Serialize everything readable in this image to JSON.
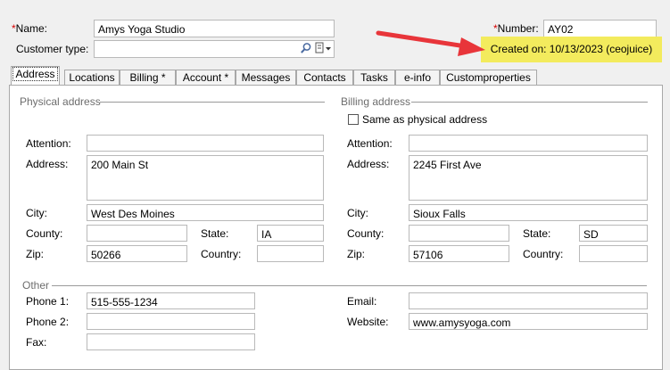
{
  "header": {
    "name_star": "*",
    "name_label": "Name:",
    "name_value": "Amys Yoga Studio",
    "customer_type_label": "Customer type:",
    "customer_type_value": "",
    "number_star": "*",
    "number_label": "Number:",
    "number_value": "AY02",
    "created_on": "Created on: 10/13/2023 (ceojuice)"
  },
  "tabs": [
    {
      "label": "Address"
    },
    {
      "label": "Locations"
    },
    {
      "label": "Billing *"
    },
    {
      "label": "Account *"
    },
    {
      "label": "Messages"
    },
    {
      "label": "Contacts"
    },
    {
      "label": "Tasks"
    },
    {
      "label": "e-info"
    },
    {
      "label": "Customproperties"
    }
  ],
  "physical": {
    "title": "Physical address",
    "attention_label": "Attention:",
    "attention_value": "",
    "address_label": "Address:",
    "address_value": "200 Main St",
    "city_label": "City:",
    "city_value": "West Des Moines",
    "county_label": "County:",
    "county_value": "",
    "state_label": "State:",
    "state_value": "IA",
    "zip_label": "Zip:",
    "zip_value": "50266",
    "country_label": "Country:",
    "country_value": ""
  },
  "billing": {
    "title": "Billing address",
    "same_label": "Same as physical address",
    "same_checked": false,
    "attention_label": "Attention:",
    "attention_value": "",
    "address_label": "Address:",
    "address_value": "2245 First Ave",
    "city_label": "City:",
    "city_value": "Sioux Falls",
    "county_label": "County:",
    "county_value": "",
    "state_label": "State:",
    "state_value": "SD",
    "zip_label": "Zip:",
    "zip_value": "57106",
    "country_label": "Country:",
    "country_value": ""
  },
  "other": {
    "title": "Other",
    "phone1_label": "Phone 1:",
    "phone1_value": "515-555-1234",
    "phone2_label": "Phone 2:",
    "phone2_value": "",
    "fax_label": "Fax:",
    "fax_value": "",
    "email_label": "Email:",
    "email_value": "",
    "website_label": "Website:",
    "website_value": "www.amysyoga.com"
  },
  "icons": {
    "search": "search-icon",
    "dropdown": "dropdown-icon",
    "arrow": "red-arrow-annotation"
  },
  "colors": {
    "highlight": "#f3eb5d",
    "arrow": "#e8353a",
    "required": "#d40000"
  }
}
